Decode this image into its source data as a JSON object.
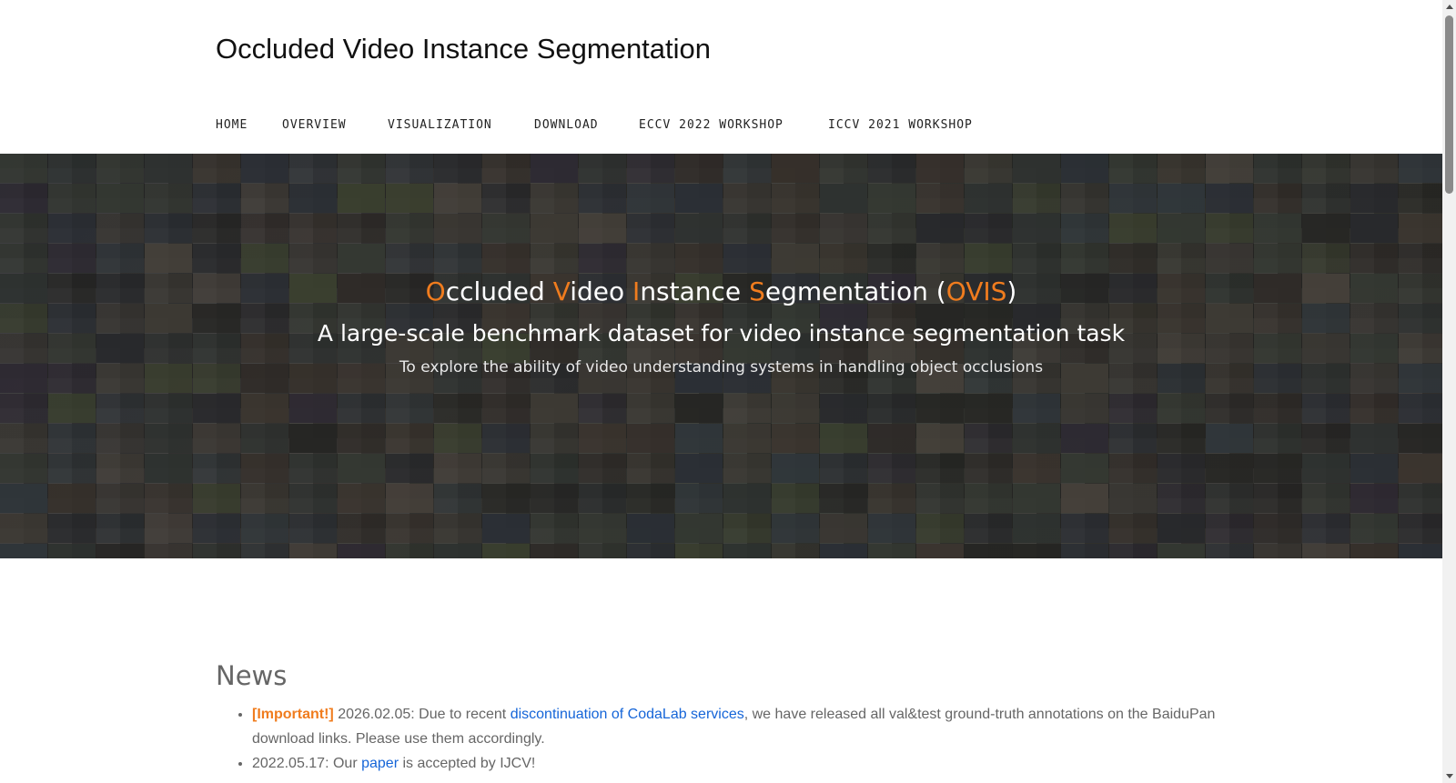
{
  "header": {
    "site_title": "Occluded Video Instance Segmentation",
    "nav": [
      {
        "label": "HOME"
      },
      {
        "label": "OVERVIEW"
      },
      {
        "label": "VISUALIZATION"
      },
      {
        "label": "DOWNLOAD"
      },
      {
        "label": "ECCV 2022 WORKSHOP"
      },
      {
        "label": "ICCV 2021 WORKSHOP"
      }
    ]
  },
  "hero": {
    "title_parts": {
      "o": "O",
      "o_rest": "ccluded ",
      "v": "V",
      "v_rest": "ideo ",
      "i": "I",
      "i_rest": "nstance ",
      "s": "S",
      "s_rest": "egmentation (",
      "acronym": "OVIS",
      "close": ")"
    },
    "subtitle": "A large-scale benchmark dataset for video instance segmentation task",
    "tagline": "To explore the ability of video understanding systems in handling object occlusions"
  },
  "news": {
    "heading": "News",
    "items": [
      {
        "tag": "[Important!]",
        "text_before": " 2026.02.05: Due to recent ",
        "link": "discontinuation of CodaLab services",
        "text_after": ", we have released all val&test ground-truth annotations on the BaiduPan download links. Please use them accordingly."
      },
      {
        "text_before": "2022.05.17: Our ",
        "link": "paper",
        "text_after": " is accepted by IJCV!"
      }
    ]
  },
  "colors": {
    "accent": "#f07c1e",
    "link": "#1565d8",
    "body_text": "#666666"
  }
}
